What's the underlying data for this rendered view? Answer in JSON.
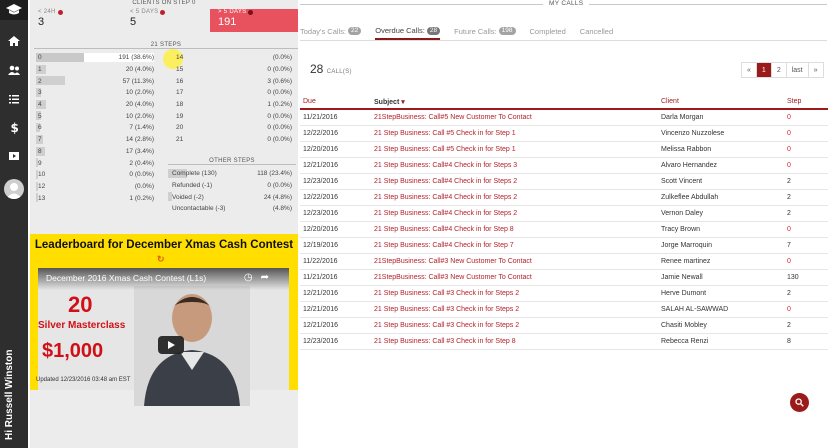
{
  "nav": {
    "greeting": "Hi Russell Winston",
    "icons": [
      "graduation-cap-icon",
      "home-icon",
      "users-icon",
      "list-icon",
      "dollar-icon",
      "video-icon",
      "avatar"
    ]
  },
  "clients_on_step_0": {
    "header": "CLIENTS ON STEP 0",
    "stats": [
      {
        "label": "< 24H",
        "value": "3"
      },
      {
        "label": "< 5 DAYS",
        "value": "5"
      },
      {
        "label": "> 5 DAYS",
        "value": "191"
      }
    ]
  },
  "steps21": {
    "header": "21 STEPS",
    "left": [
      {
        "step": "0",
        "value": "191 (38.6%)",
        "fraction": 0.386
      },
      {
        "step": "1",
        "value": "20 (4.0%)",
        "fraction": 0.04
      },
      {
        "step": "2",
        "value": "57 (11.3%)",
        "fraction": 0.113
      },
      {
        "step": "3",
        "value": "10 (2.0%)",
        "fraction": 0.02
      },
      {
        "step": "4",
        "value": "20 (4.0%)",
        "fraction": 0.04
      },
      {
        "step": "5",
        "value": "10 (2.0%)",
        "fraction": 0.02
      },
      {
        "step": "6",
        "value": "7 (1.4%)",
        "fraction": 0.014
      },
      {
        "step": "7",
        "value": "14 (2.8%)",
        "fraction": 0.028
      },
      {
        "step": "8",
        "value": "17 (3.4%)",
        "fraction": 0.034
      },
      {
        "step": "9",
        "value": "2 (0.4%)",
        "fraction": 0.004
      },
      {
        "step": "10",
        "value": "0 (0.0%)",
        "fraction": 0.0
      },
      {
        "step": "12",
        "value": "(0.0%)",
        "fraction": 0.0
      },
      {
        "step": "13",
        "value": "1 (0.2%)",
        "fraction": 0.002
      }
    ],
    "right": [
      {
        "step": "14",
        "value": "(0.0%)"
      },
      {
        "step": "15",
        "value": "0 (0.0%)"
      },
      {
        "step": "16",
        "value": "3 (0.6%)"
      },
      {
        "step": "17",
        "value": "0 (0.0%)"
      },
      {
        "step": "18",
        "value": "1 (0.2%)"
      },
      {
        "step": "19",
        "value": "0 (0.0%)"
      },
      {
        "step": "20",
        "value": "0 (0.0%)"
      },
      {
        "step": "21",
        "value": "0 (0.0%)"
      }
    ]
  },
  "other_steps": {
    "header": "OTHER STEPS",
    "rows": [
      {
        "label": "Complete (130)",
        "value": "118 (23.4%)",
        "fraction": 0.234
      },
      {
        "label": "Refunded (-1)",
        "value": "0 (0.0%)",
        "fraction": 0.0
      },
      {
        "label": "Voided (-2)",
        "value": "24 (4.8%)",
        "fraction": 0.048
      },
      {
        "label": "Uncontactable (-3)",
        "value": "(4.8%)",
        "fraction": 0.0
      }
    ]
  },
  "leaderboard": {
    "title": "Leaderboard for December Xmas Cash Contest",
    "video_title": "December 2016 Xmas Cash Contest (L1s)",
    "video_text_1": "20",
    "video_text_2": "Silver Masterclass",
    "video_text_3": "$1,000",
    "updated": "Updated 12/23/2016 03:48 am EST"
  },
  "calls": {
    "section_title": "MY CALLS",
    "tabs": [
      {
        "label": "Today's Calls:",
        "badge": "22"
      },
      {
        "label": "Overdue Calls:",
        "badge": "28"
      },
      {
        "label": "Future Calls:",
        "badge": "198"
      },
      {
        "label": "Completed",
        "badge": ""
      },
      {
        "label": "Cancelled",
        "badge": ""
      }
    ],
    "count": "28",
    "count_label": "CALL(S)",
    "pager": [
      "«",
      "1",
      "2",
      "last",
      "»"
    ],
    "columns": [
      "Due",
      "Subject",
      "Client",
      "Step"
    ],
    "rows": [
      {
        "due": "11/21/2016",
        "subject": "21StepBusiness: Call#5 New Customer To Contact",
        "client": "Darla Morgan",
        "step": "0"
      },
      {
        "due": "12/22/2016",
        "subject": "21 Step Business: Call #5 Check in for Step 1",
        "client": "Vincenzo Nuzzolese",
        "step": "0"
      },
      {
        "due": "12/20/2016",
        "subject": "21 Step Business: Call #5 Check in for Step 1",
        "client": "Melissa Rabbon",
        "step": "0"
      },
      {
        "due": "12/21/2016",
        "subject": "21 Step Business: Call#4 Check in for Steps 3",
        "client": "Alvaro Hernandez",
        "step": "0"
      },
      {
        "due": "12/23/2016",
        "subject": "21 Step Business: Call#4 Check in for Steps 2",
        "client": "Scott Vincent",
        "step": "2"
      },
      {
        "due": "12/22/2016",
        "subject": "21 Step Business: Call#4 Check in for Steps 2",
        "client": "Zulkeflee Abdullah",
        "step": "2"
      },
      {
        "due": "12/23/2016",
        "subject": "21 Step Business: Call#4 Check in for Steps 2",
        "client": "Vernon Daley",
        "step": "2"
      },
      {
        "due": "12/20/2016",
        "subject": "21 Step Business: Call#4 Check in for Step 8",
        "client": "Tracy Brown",
        "step": "0"
      },
      {
        "due": "12/19/2016",
        "subject": "21 Step Business: Call#4 Check in for Step 7",
        "client": "Jorge Marroquin",
        "step": "7"
      },
      {
        "due": "11/22/2016",
        "subject": "21StepBusiness: Call#3 New Customer To Contact",
        "client": "Renee martinez",
        "step": "0"
      },
      {
        "due": "11/21/2016",
        "subject": "21StepBusiness: Call#3 New Customer To Contact",
        "client": "Jamie Newall",
        "step": "130"
      },
      {
        "due": "12/21/2016",
        "subject": "21 Step Business: Call #3 Check in for Steps 2",
        "client": "Herve Dumont",
        "step": "2"
      },
      {
        "due": "12/21/2016",
        "subject": "21 Step Business: Call #3 Check in for Steps 2",
        "client": "SALAH AL-SAWWAD",
        "step": "0"
      },
      {
        "due": "12/21/2016",
        "subject": "21 Step Business: Call #3 Check in for Steps 2",
        "client": "Chasiti Mobley",
        "step": "2"
      },
      {
        "due": "12/23/2016",
        "subject": "21 Step Business: Call #3 Check in for Step 8",
        "client": "Rebecca Renzi",
        "step": "8"
      }
    ]
  },
  "colors": {
    "brand": "#9b1b1b",
    "alert": "#e8525e",
    "highlight": "#ffde00"
  }
}
